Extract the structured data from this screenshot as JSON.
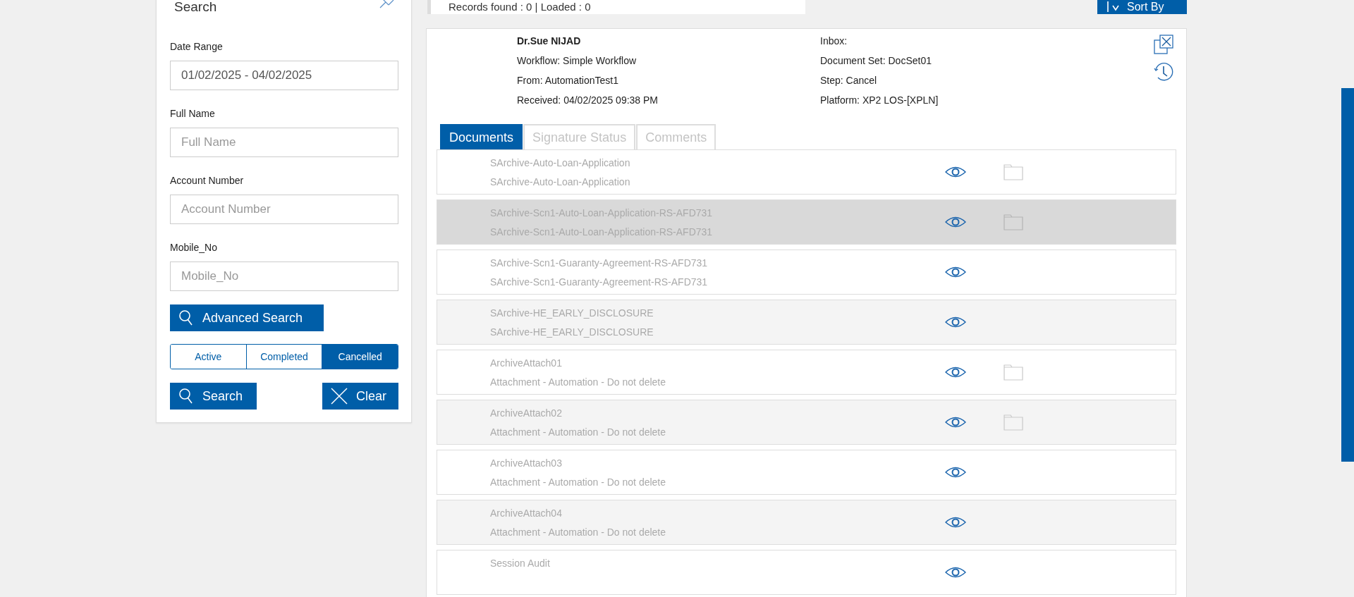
{
  "search_panel": {
    "title": "Search",
    "fields": [
      {
        "label": "Date Range",
        "value": "01/02/2025 - 04/02/2025"
      },
      {
        "label": "Full Name",
        "placeholder": "Full Name"
      },
      {
        "label": "Account Number",
        "placeholder": "Account Number"
      },
      {
        "label": "Mobile_No",
        "placeholder": "Mobile_No"
      }
    ],
    "advanced_button": "Advanced Search",
    "status_filter": [
      {
        "label": "Active",
        "selected": false
      },
      {
        "label": "Completed",
        "selected": false
      },
      {
        "label": "Cancelled",
        "selected": true
      }
    ],
    "search_button": "Search",
    "clear_button": "Clear"
  },
  "results_bar": {
    "summary": "Records found : 0 | Loaded : 0",
    "sort_button": "Sort By"
  },
  "detail": {
    "name": "Dr.Sue NIJAD",
    "left_lines": [
      "Workflow: Simple Workflow",
      "From: AutomationTest1",
      "Received: 04/02/2025 09:38 PM"
    ],
    "right_lines": [
      "Inbox:",
      "Document Set: DocSet01",
      "Step: Cancel",
      "Platform: XP2 LOS-[XPLN]"
    ],
    "tabs": [
      {
        "label": "Documents",
        "selected": true
      },
      {
        "label": "Signature Status",
        "selected": false
      },
      {
        "label": "Comments",
        "selected": false
      }
    ],
    "documents": [
      {
        "title": "SArchive-Auto-Loan-Application",
        "subtitle": "SArchive-Auto-Loan-Application",
        "selected": false,
        "folder": true
      },
      {
        "title": "SArchive-Scn1-Auto-Loan-Application-RS-AFD731",
        "subtitle": "SArchive-Scn1-Auto-Loan-Application-RS-AFD731",
        "selected": true,
        "folder": true
      },
      {
        "title": "SArchive-Scn1-Guaranty-Agreement-RS-AFD731",
        "subtitle": "SArchive-Scn1-Guaranty-Agreement-RS-AFD731",
        "selected": false,
        "folder": false
      },
      {
        "title": "SArchive-HE_EARLY_DISCLOSURE",
        "subtitle": "SArchive-HE_EARLY_DISCLOSURE",
        "selected": false,
        "folder": false
      },
      {
        "title": "ArchiveAttach01",
        "subtitle": "Attachment - Automation - Do not delete",
        "selected": false,
        "folder": true
      },
      {
        "title": "ArchiveAttach02",
        "subtitle": "Attachment - Automation - Do not delete",
        "selected": false,
        "folder": true
      },
      {
        "title": "ArchiveAttach03",
        "subtitle": "Attachment - Automation - Do not delete",
        "selected": false,
        "folder": false
      },
      {
        "title": "ArchiveAttach04",
        "subtitle": "Attachment - Automation - Do not delete",
        "selected": false,
        "folder": false
      },
      {
        "title": "Session Audit",
        "selected": false,
        "folder": false
      }
    ]
  }
}
